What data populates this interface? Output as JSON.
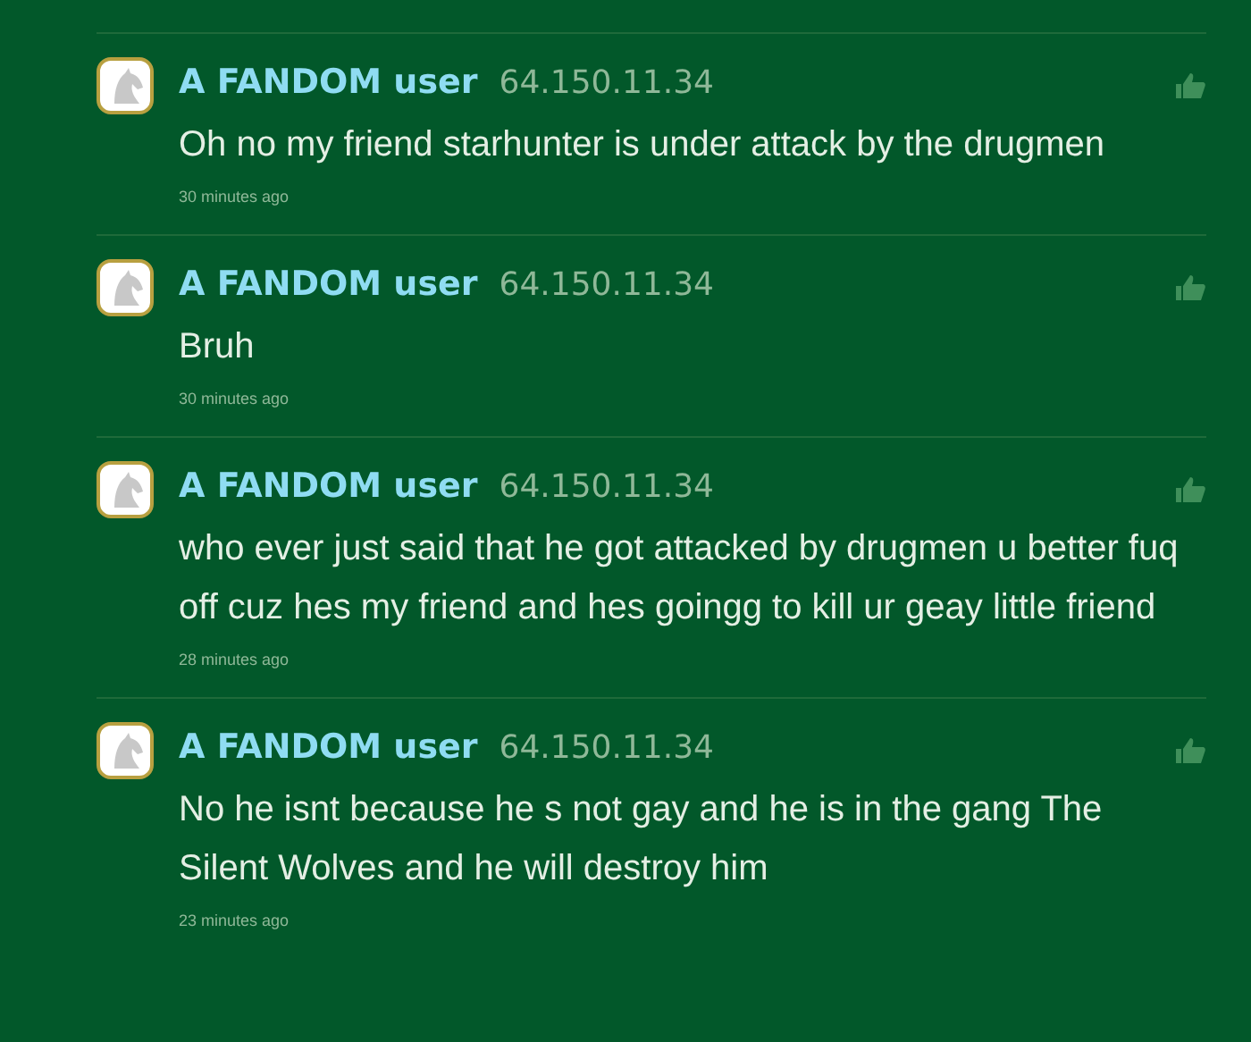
{
  "comments": [
    {
      "author": "A FANDOM user",
      "ip": "64.150.11.34",
      "text": "Oh no my friend starhunter is under attack by the drugmen",
      "time": "30 minutes ago"
    },
    {
      "author": "A FANDOM user",
      "ip": "64.150.11.34",
      "text": "Bruh",
      "time": "30 minutes ago"
    },
    {
      "author": "A FANDOM user",
      "ip": "64.150.11.34",
      "text": "who ever just said that he got attacked by drugmen u better fuq off cuz hes my friend and hes goingg to kill ur geay little friend",
      "time": "28 minutes ago"
    },
    {
      "author": "A FANDOM user",
      "ip": "64.150.11.34",
      "text": "No he isnt because he s not gay and he is in the gang The Silent Wolves and he will destroy him",
      "time": "23 minutes ago"
    }
  ]
}
